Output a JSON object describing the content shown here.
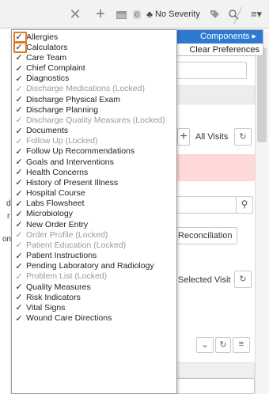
{
  "toolbar": {
    "count_badge": "0",
    "severity_label": "No Severity"
  },
  "component_panel": {
    "components_label": "Components ▸",
    "clear_label": "Clear Preferences"
  },
  "background": {
    "all_visits": "All Visits",
    "reconciliation": "Reconciliation",
    "selected_visit": "Selected Visit"
  },
  "menu": {
    "items": [
      {
        "label": "Allergies",
        "locked": false
      },
      {
        "label": "Calculators",
        "locked": false
      },
      {
        "label": "Care Team",
        "locked": false
      },
      {
        "label": "Chief Complaint",
        "locked": false
      },
      {
        "label": "Diagnostics",
        "locked": false
      },
      {
        "label": "Discharge Medications (Locked)",
        "locked": true
      },
      {
        "label": "Discharge Physical Exam",
        "locked": false
      },
      {
        "label": "Discharge Planning",
        "locked": false
      },
      {
        "label": "Discharge Quality Measures (Locked)",
        "locked": true
      },
      {
        "label": "Documents",
        "locked": false
      },
      {
        "label": "Follow Up (Locked)",
        "locked": true
      },
      {
        "label": "Follow Up Recommendations",
        "locked": false
      },
      {
        "label": "Goals and Interventions",
        "locked": false
      },
      {
        "label": "Health Concerns",
        "locked": false
      },
      {
        "label": "History of Present Illness",
        "locked": false
      },
      {
        "label": "Hospital Course",
        "locked": false
      },
      {
        "label": "Labs Flowsheet",
        "locked": false
      },
      {
        "label": "Microbiology",
        "locked": false
      },
      {
        "label": "New Order Entry",
        "locked": false
      },
      {
        "label": "Order Profile (Locked)",
        "locked": true
      },
      {
        "label": "Patient Education (Locked)",
        "locked": true
      },
      {
        "label": "Patient Instructions",
        "locked": false
      },
      {
        "label": "Pending Laboratory and Radiology",
        "locked": false
      },
      {
        "label": "Problem List (Locked)",
        "locked": true
      },
      {
        "label": "Quality Measures",
        "locked": false
      },
      {
        "label": "Risk Indicators",
        "locked": false
      },
      {
        "label": "Vital Signs",
        "locked": false
      },
      {
        "label": "Wound Care Directions",
        "locked": false
      }
    ]
  }
}
